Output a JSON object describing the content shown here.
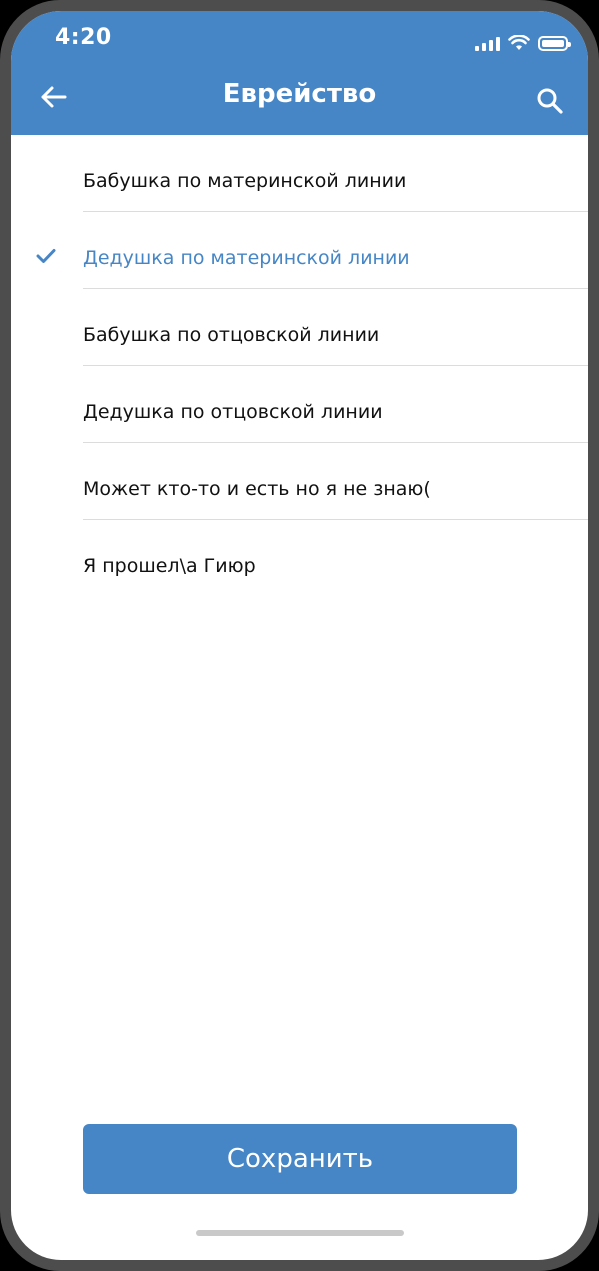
{
  "status_bar": {
    "time": "4:20"
  },
  "header": {
    "title": "Еврейство",
    "back_icon": "arrow-left-icon",
    "search_icon": "search-icon"
  },
  "options": [
    {
      "label": "Бабушка по материнской линии",
      "selected": false
    },
    {
      "label": "Дедушка по материнской линии",
      "selected": true
    },
    {
      "label": "Бабушка по отцовской линии",
      "selected": false
    },
    {
      "label": "Дедушка по отцовской линии",
      "selected": false
    },
    {
      "label": "Может кто-то и есть но я не знаю(",
      "selected": false
    },
    {
      "label": "Я прошел\\а Гиюр",
      "selected": false
    }
  ],
  "footer": {
    "save_label": "Сохранить"
  },
  "colors": {
    "accent": "#4786c6",
    "divider": "#dcdcdc",
    "text": "#111111"
  }
}
